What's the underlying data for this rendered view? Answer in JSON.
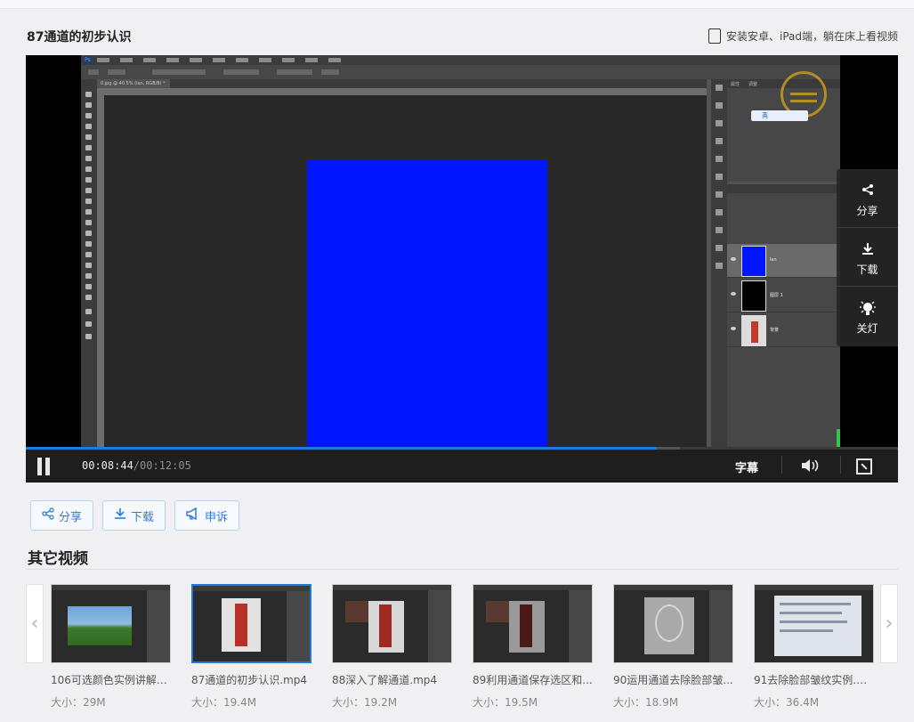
{
  "page": {
    "title": "87通道的初步认识",
    "mobile_hint": "安装安卓、iPad端，躺在床上看视频"
  },
  "player": {
    "current_time": "00:08:44",
    "duration": "/00:12:05",
    "progress_fraction": 0.723,
    "buffered_fraction": 0.75,
    "subtitle_label": "字幕",
    "side_menu": [
      {
        "label": "分享",
        "icon": "share-icon"
      },
      {
        "label": "下载",
        "icon": "download-icon"
      },
      {
        "label": "关灯",
        "icon": "lightbulb-icon"
      }
    ],
    "screen": {
      "tab_title": "0.jpg @ 40.5% (lan, RGB/8) *",
      "layers": [
        "lan",
        "图层 1",
        "背景"
      ],
      "ime_label": "英"
    }
  },
  "actions": [
    {
      "label": "分享",
      "icon": "share-icon"
    },
    {
      "label": "下载",
      "icon": "download-icon"
    },
    {
      "label": "申诉",
      "icon": "megaphone-icon"
    }
  ],
  "other_videos": {
    "heading": "其它视频",
    "items": [
      {
        "name": "106可选颜色实例讲解之...",
        "size": "大小：29M"
      },
      {
        "name": "87通道的初步认识.mp4",
        "size": "大小：19.4M"
      },
      {
        "name": "88深入了解通道.mp4",
        "size": "大小：19.2M"
      },
      {
        "name": "89利用通道保存选区和...",
        "size": "大小：19.5M"
      },
      {
        "name": "90运用通道去除脸部皱...",
        "size": "大小：18.9M"
      },
      {
        "name": "91去除脸部皱纹实例.m...",
        "size": "大小：36.4M"
      }
    ]
  },
  "colors": {
    "accent": "#1f7ae0",
    "document_blue": "#0015ff"
  }
}
